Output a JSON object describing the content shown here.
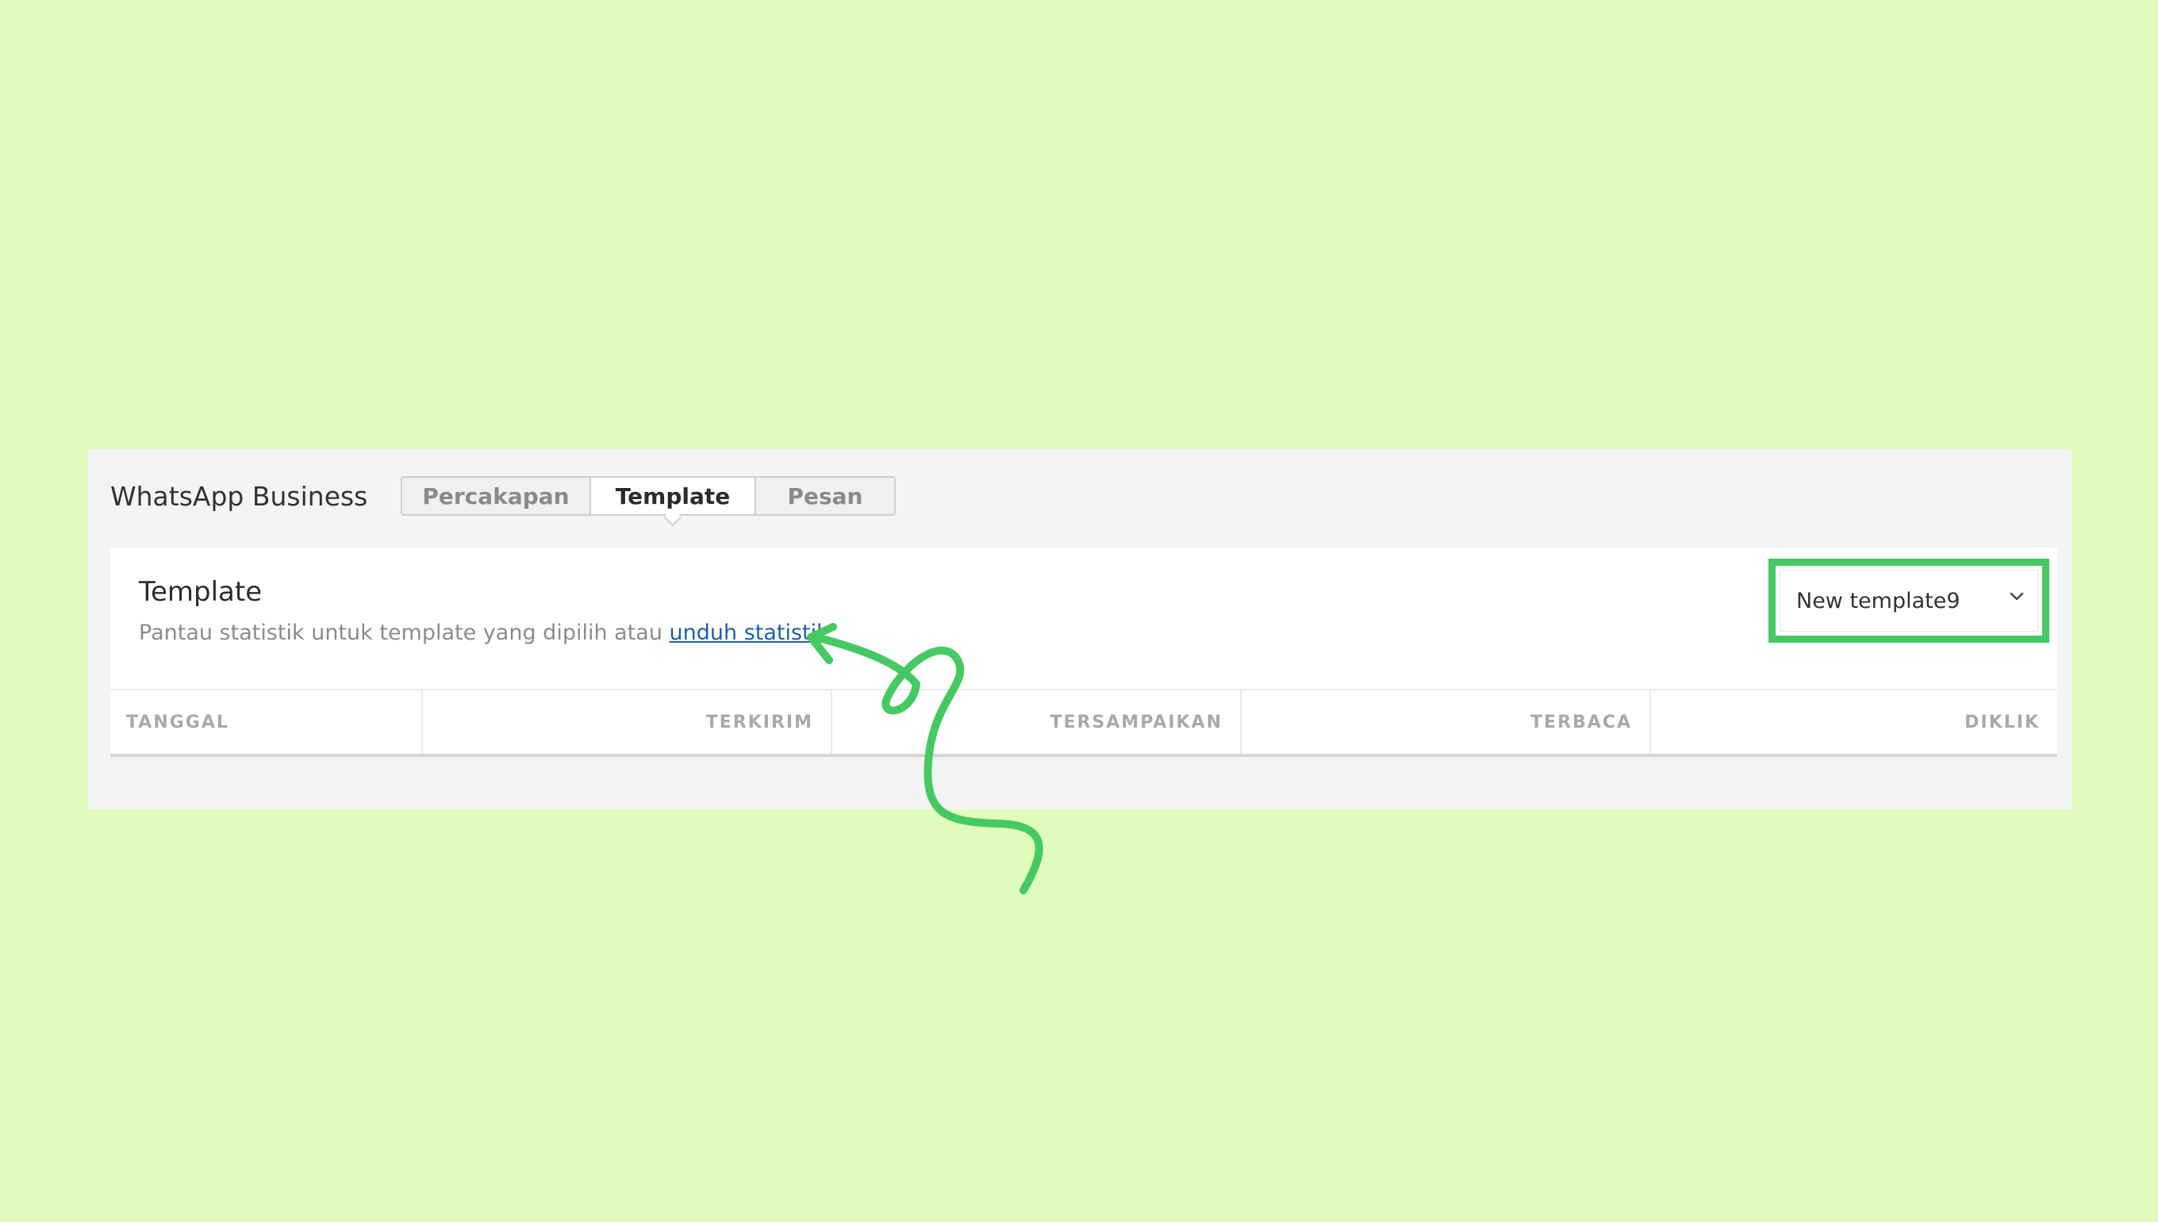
{
  "app": {
    "title": "WhatsApp Business"
  },
  "tabs": [
    {
      "label": "Percakapan",
      "active": false
    },
    {
      "label": "Template",
      "active": true
    },
    {
      "label": "Pesan",
      "active": false
    }
  ],
  "card": {
    "title": "Template",
    "description": "Pantau statistik untuk template yang dipilih atau ",
    "link_label": "unduh statistik"
  },
  "template_select": {
    "selected": "New template9",
    "icon": "chevron-down-icon"
  },
  "table": {
    "columns": [
      "TANGGAL",
      "TERKIRIM",
      "TERSAMPAIKAN",
      "TERBACA",
      "DIKLIK"
    ],
    "rows": []
  },
  "colors": {
    "background": "#e0fcbc",
    "highlight": "#45c962",
    "link": "#1f5fa8"
  }
}
